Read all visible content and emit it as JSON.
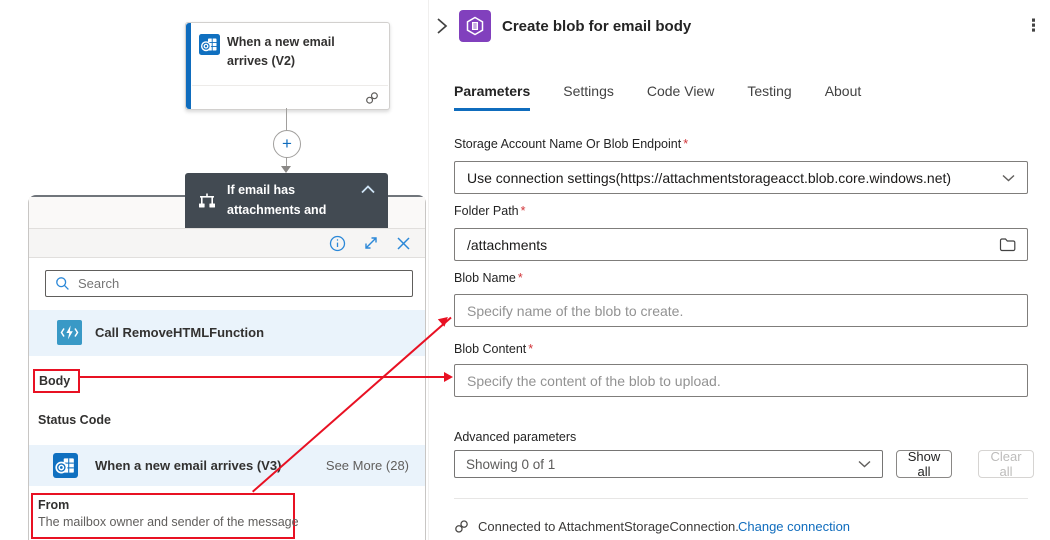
{
  "canvas": {
    "trigger": {
      "title": "When a new email arrives (V2)"
    },
    "condition": {
      "line1": "If email has",
      "line2": "attachments and"
    }
  },
  "picker": {
    "search_placeholder": "Search",
    "function_row": "Call RemoveHTMLFunction",
    "body_token": "Body",
    "status_code": "Status Code",
    "email_row": "When a new email arrives (V3)",
    "see_more": "See More (28)",
    "from_token": "From",
    "from_description": "The mailbox owner and sender of the message"
  },
  "panel": {
    "title": "Create blob for email body",
    "tabs": [
      "Parameters",
      "Settings",
      "Code View",
      "Testing",
      "About"
    ],
    "required_mark": "*",
    "fields": {
      "storage": {
        "label": "Storage Account Name Or Blob Endpoint",
        "value": "Use connection settings(https://attachmentstorageacct.blob.core.windows.net)"
      },
      "folder": {
        "label": "Folder Path",
        "value": "/attachments"
      },
      "blob_name": {
        "label": "Blob Name",
        "placeholder": "Specify name of the blob to create."
      },
      "blob_content": {
        "label": "Blob Content",
        "placeholder": "Specify the content of the blob to upload."
      }
    },
    "advanced": {
      "label": "Advanced parameters",
      "dropdown_value": "Showing 0 of 1",
      "show_all": "Show all",
      "clear_all": "Clear all"
    },
    "footer": {
      "connected": "Connected to AttachmentStorageConnection.",
      "change_link": "Change connection"
    }
  },
  "icons": {
    "plus": "+",
    "more_vertical": "⋮"
  },
  "colors": {
    "accent_blue": "#0f6cbd",
    "annotation_red": "#e81123",
    "condition_dark": "#424a52",
    "connector_purple": "#8140bd",
    "row_highlight": "#eaf3fb"
  }
}
